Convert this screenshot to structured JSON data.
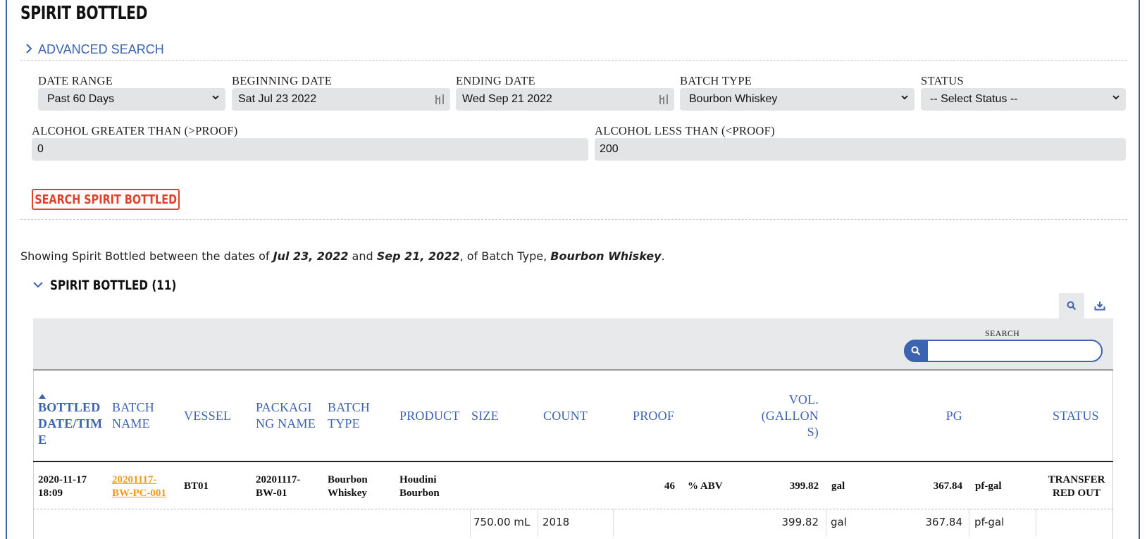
{
  "page": {
    "title": "SPIRIT BOTTLED"
  },
  "advanced_search": {
    "label": "ADVANCED SEARCH"
  },
  "filters": {
    "date_range": {
      "label": "DATE RANGE",
      "value": "Past 60 Days"
    },
    "beginning_date": {
      "label": "BEGINNING DATE",
      "value": "Sat Jul 23 2022"
    },
    "ending_date": {
      "label": "ENDING DATE",
      "value": "Wed Sep 21 2022"
    },
    "batch_type": {
      "label": "BATCH TYPE",
      "value": "Bourbon Whiskey"
    },
    "status": {
      "label": "STATUS",
      "value": "-- Select Status --"
    },
    "alcohol_gt": {
      "label": "ALCOHOL GREATER THAN (>PROOF)",
      "value": "0"
    },
    "alcohol_lt": {
      "label": "ALCOHOL LESS THAN (<PROOF)",
      "value": "200"
    }
  },
  "search_button": {
    "label": "SEARCH SPIRIT BOTTLED"
  },
  "summary": {
    "prefix": "Showing Spirit Bottled between the dates of ",
    "start": "Jul 23, 2022",
    "and": " and ",
    "end": "Sep 21, 2022",
    "mid": ", of Batch Type, ",
    "batch_type": "Bourbon Whiskey",
    "suffix": "."
  },
  "section": {
    "title": "SPIRIT BOTTLED (11)"
  },
  "table_search": {
    "label": "SEARCH",
    "value": ""
  },
  "columns": {
    "bottled": [
      "BOTTLED",
      "DATE/TIM",
      "E"
    ],
    "batch_name": [
      "BATCH",
      "NAME"
    ],
    "vessel": "VESSEL",
    "packaging": [
      "PACKAGI",
      "NG NAME"
    ],
    "batch_type": [
      "BATCH",
      "TYPE"
    ],
    "product": "PRODUCT",
    "size": "SIZE",
    "count": "COUNT",
    "proof": "PROOF",
    "vol": [
      "VOL.",
      "(GALLON",
      "S)"
    ],
    "pg": "PG",
    "status": "STATUS"
  },
  "rows": [
    {
      "bottled": [
        "2020-11-17",
        "18:09"
      ],
      "batch_name": [
        "20201117-",
        "BW-PC-001"
      ],
      "vessel": "BT01",
      "packaging": [
        "20201117-",
        "BW-01"
      ],
      "batch_type": [
        "Bourbon",
        "Whiskey"
      ],
      "product": [
        "Houdini",
        "Bourbon"
      ],
      "proof": "46",
      "proof_unit": "% ABV",
      "vol": "399.82",
      "vol_unit": "gal",
      "pg": "367.84",
      "pg_unit": "pf-gal",
      "status": [
        "TRANSFER",
        "RED OUT"
      ],
      "detail": {
        "size": "750.00 mL",
        "count": "2018",
        "vol": "399.82",
        "vol_unit": "gal",
        "pg": "367.84",
        "pg_unit": "pf-gal"
      }
    }
  ]
}
